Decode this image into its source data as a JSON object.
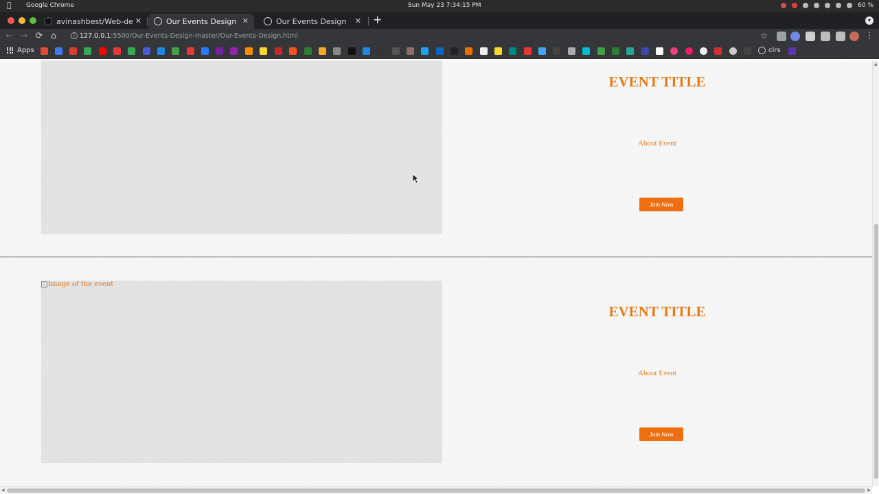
{
  "os": {
    "app_name": "Google Chrome",
    "datetime": "Sun May 23   7:34:15 PM",
    "battery": "60 %"
  },
  "tabs": [
    {
      "title": "avinashbest/Web-dev-Pr",
      "active": false
    },
    {
      "title": "Our Events Design",
      "active": true
    },
    {
      "title": "Our Events Design",
      "active": false
    }
  ],
  "omnibox": {
    "url_host": "127.0.0.1",
    "url_path": ":5500/Our-Events-Design-master/Our-Events-Design.html"
  },
  "bookmarks": {
    "apps_label": "Apps",
    "last_label": "clrs"
  },
  "events": [
    {
      "title": "EVENT TITLE",
      "about": "About Event",
      "button": "Join Now",
      "image_alt": ""
    },
    {
      "title": "EVENT TITLE",
      "about": "About Event",
      "button": "Join Now",
      "image_alt": "Image of the event"
    }
  ],
  "colors": {
    "accent_text": "#e57b17",
    "button_bg": "#ee6f10",
    "chrome_dark": "#202124"
  }
}
